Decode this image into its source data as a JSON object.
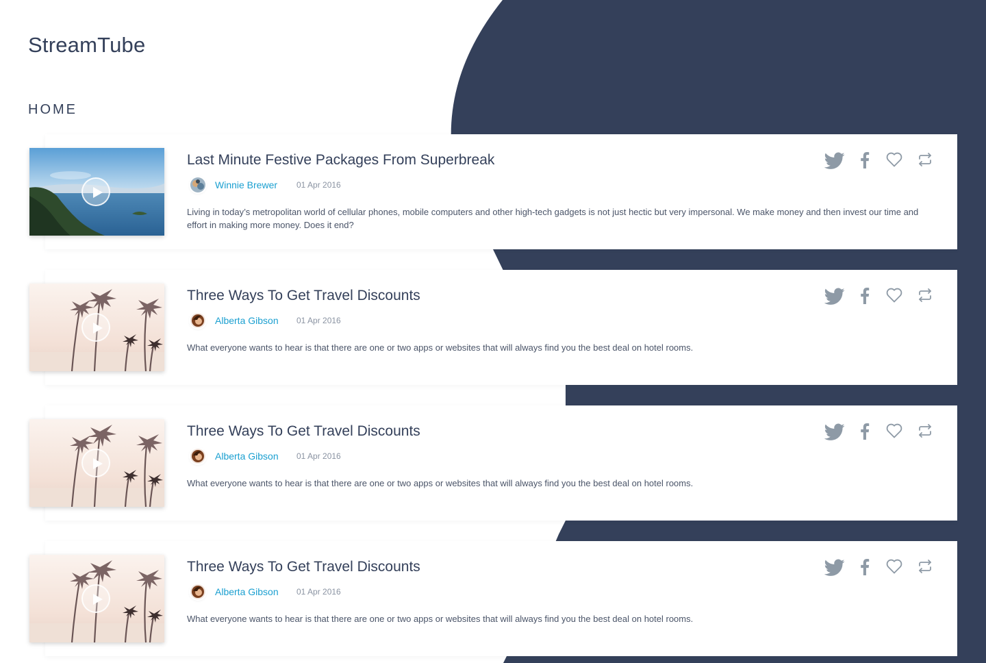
{
  "app": {
    "brand": "StreamTube",
    "section_title": "HOME"
  },
  "colors": {
    "navy": "#34405a",
    "author_link": "#1a9fd0",
    "icon_gray": "#8e9aa6",
    "card_bg": "#ffffff"
  },
  "icons": {
    "play": "play-icon",
    "twitter": "twitter-icon",
    "facebook": "facebook-icon",
    "like": "heart-icon",
    "share": "repost-icon"
  },
  "videos": [
    {
      "thumbnail": "lake-landscape",
      "title": "Last Minute Festive Packages From Superbreak",
      "author": "Winnie Brewer",
      "date": "01 Apr 2016",
      "description": "Living in today’s metropolitan world of cellular phones, mobile computers and other high-tech gadgets is not just hectic but very impersonal. We make money and then invest our time and effort in making more money. Does it end?"
    },
    {
      "thumbnail": "palm-trees",
      "title": "Three Ways To Get Travel Discounts",
      "author": "Alberta Gibson",
      "date": "01 Apr 2016",
      "description": "What everyone wants to hear is that there are one or two apps or websites that will always find you the best deal on hotel rooms."
    },
    {
      "thumbnail": "palm-trees",
      "title": "Three Ways To Get Travel Discounts",
      "author": "Alberta Gibson",
      "date": "01 Apr 2016",
      "description": "What everyone wants to hear is that there are one or two apps or websites that will always find you the best deal on hotel rooms."
    },
    {
      "thumbnail": "palm-trees",
      "title": "Three Ways To Get Travel Discounts",
      "author": "Alberta Gibson",
      "date": "01 Apr 2016",
      "description": "What everyone wants to hear is that there are one or two apps or websites that will always find you the best deal on hotel rooms."
    }
  ]
}
